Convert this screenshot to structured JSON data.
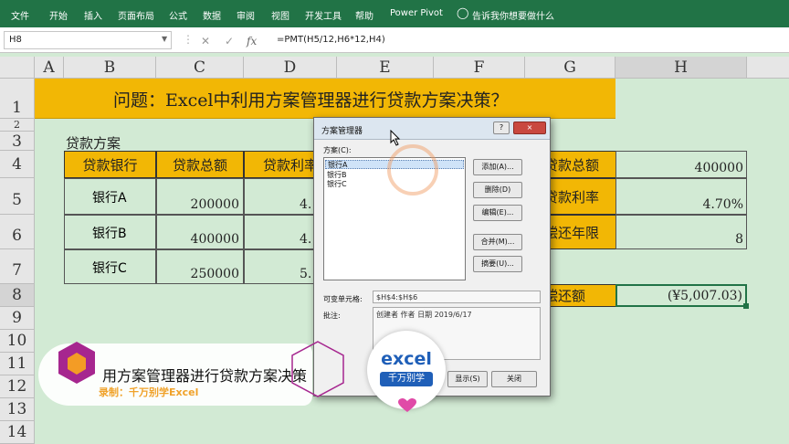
{
  "ribbon_tabs": [
    "文件",
    "开始",
    "插入",
    "页面布局",
    "公式",
    "数据",
    "审阅",
    "视图",
    "开发工具",
    "帮助",
    "Power Pivot"
  ],
  "tell_me": "告诉我你想要做什么",
  "name_box": "H8",
  "formula": "=PMT(H5/12,H6*12,H4)",
  "columns": [
    "A",
    "B",
    "C",
    "D",
    "E",
    "F",
    "G",
    "H"
  ],
  "rows": [
    "1",
    "2",
    "3",
    "4",
    "5",
    "6",
    "7",
    "8",
    "9",
    "10",
    "11",
    "12",
    "13",
    "14"
  ],
  "title": "问题：Excel中利用方案管理器进行贷款方案决策？",
  "section_label": "贷款方案",
  "table": {
    "headers": [
      "贷款银行",
      "贷款总额",
      "贷款利率"
    ],
    "rows": [
      {
        "bank": "银行A",
        "amount": "200000",
        "rate": "4."
      },
      {
        "bank": "银行B",
        "amount": "400000",
        "rate": "4."
      },
      {
        "bank": "银行C",
        "amount": "250000",
        "rate": "5."
      }
    ]
  },
  "right_panel": {
    "labels": [
      "贷款总额",
      "贷款利率",
      "偿还年限",
      "偿还额"
    ],
    "label_prefixes": [
      "贷",
      "贷",
      "偿",
      "偿"
    ],
    "values": [
      "400000",
      "4.70%",
      "8",
      "(¥5,007.03)"
    ]
  },
  "dialog": {
    "title": "方案管理器",
    "help": "?",
    "close": "×",
    "scenarios_label": "方案(C):",
    "scenarios": [
      "银行A",
      "银行B",
      "银行C"
    ],
    "buttons": [
      "添加(A)...",
      "删除(D)",
      "编辑(E)...",
      "合并(M)...",
      "摘要(U)..."
    ],
    "changing_cells_label": "可变单元格:",
    "changing_cells": "$H$4:$H$6",
    "comment_label": "批注:",
    "comment": "创建者 作者 日期 2019/6/17",
    "show_button": "显示(S)",
    "close_button": "关闭"
  },
  "overlay": {
    "caption": "用方案管理器进行贷款方案决策",
    "credit": "录制：千万别学Excel",
    "logo_top": "excel",
    "logo_bottom": "千万别学"
  },
  "colors": {
    "ribbon": "#217346",
    "header_fill": "#f2b705",
    "sheet_bg": "#d2ead4",
    "credit": "#f0a22a"
  }
}
